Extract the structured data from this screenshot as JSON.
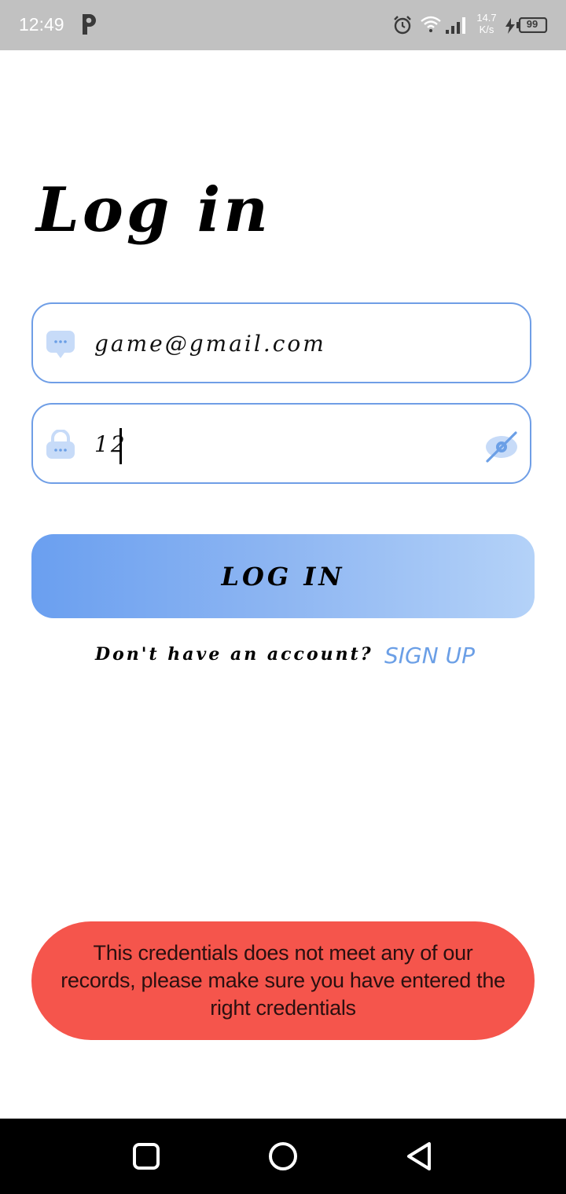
{
  "status_bar": {
    "time": "12:49",
    "net_speed_value": "14.7",
    "net_speed_unit": "K/s",
    "battery": "99"
  },
  "title": "Log in",
  "email_field": {
    "value": "game@gmail.com",
    "icon": "message-icon"
  },
  "password_field": {
    "value": "12",
    "icon": "lock-icon",
    "toggle_icon": "eye-off-icon"
  },
  "login_button": "LOG IN",
  "signup": {
    "prompt": "Don't have an account?",
    "link": "SIGN UP"
  },
  "error_message": "This credentials does not meet any of our records, please make sure you have entered the right credentials",
  "colors": {
    "accent": "#6b9fe6",
    "error": "#f5554c",
    "status_bar": "#c1c1c1"
  },
  "nav": {
    "recent": "recent-apps-icon",
    "home": "home-icon",
    "back": "back-icon"
  }
}
